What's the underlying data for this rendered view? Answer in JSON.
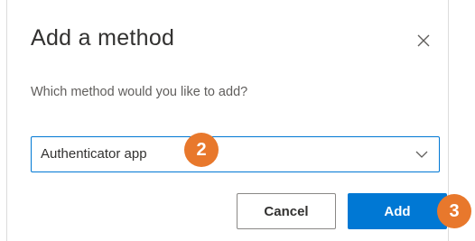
{
  "dialog": {
    "title": "Add a method",
    "close_icon": "close-icon",
    "prompt": "Which method would you like to add?",
    "select": {
      "value": "Authenticator app",
      "icon": "chevron-down-icon"
    },
    "badges": {
      "step2": "2",
      "step3": "3"
    },
    "buttons": {
      "cancel": "Cancel",
      "add": "Add"
    }
  },
  "colors": {
    "accent": "#0078d4",
    "badge": "#e8782c",
    "text": "#323130",
    "muted": "#605e5c"
  }
}
